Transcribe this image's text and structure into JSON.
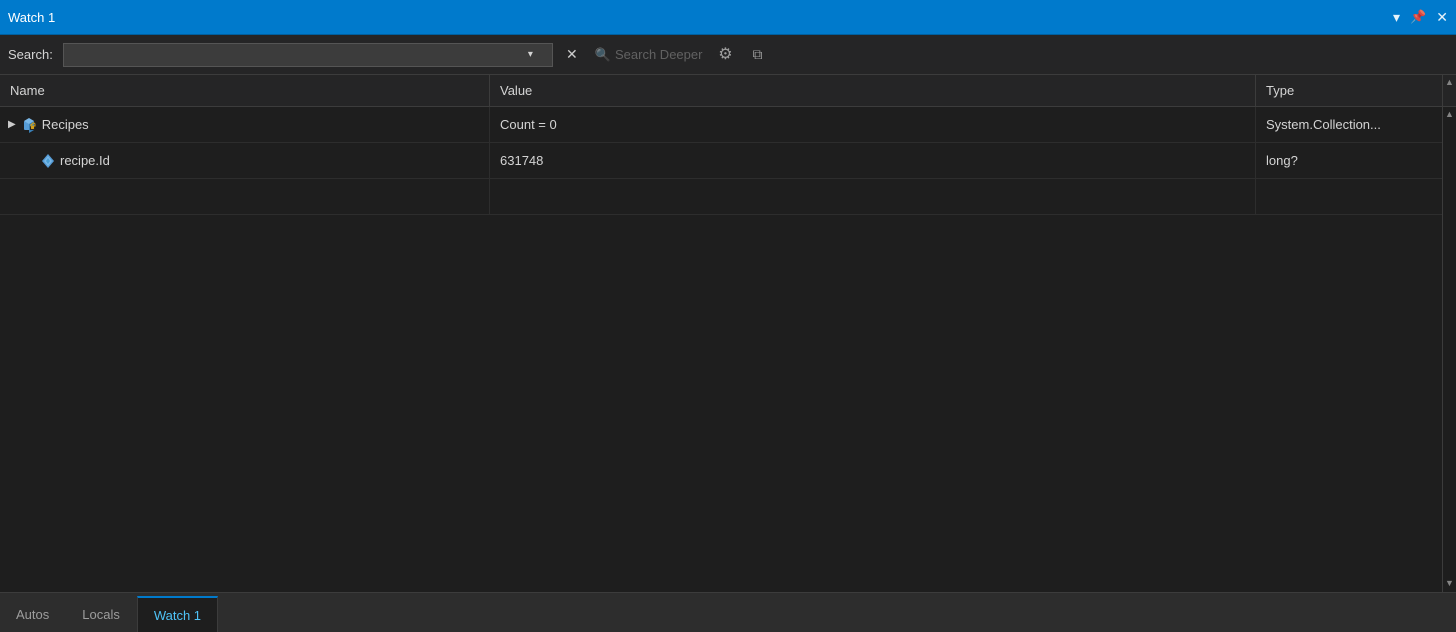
{
  "titleBar": {
    "title": "Watch 1",
    "controls": {
      "dropdown": "▾",
      "pin": "📌",
      "close": "✕"
    }
  },
  "toolbar": {
    "searchLabel": "Search:",
    "searchPlaceholder": "",
    "searchValue": "",
    "clearButton": "✕",
    "searchDeeperLabel": "Search Deeper",
    "searchDeeperIcon": "🔍",
    "gearIcon": "⚙",
    "collapseIcon": "⧉"
  },
  "columns": {
    "name": "Name",
    "value": "Value",
    "type": "Type"
  },
  "rows": [
    {
      "indent": 0,
      "expandable": true,
      "iconType": "cube-lock",
      "name": "Recipes",
      "value": "Count = 0",
      "type": "System.Collection..."
    },
    {
      "indent": 1,
      "expandable": false,
      "iconType": "diamond",
      "name": "recipe.Id",
      "value": "631748",
      "type": "long?"
    }
  ],
  "emptyRow": {
    "name": "",
    "value": "",
    "type": ""
  },
  "tabs": [
    {
      "label": "Autos",
      "active": false
    },
    {
      "label": "Locals",
      "active": false
    },
    {
      "label": "Watch 1",
      "active": true
    }
  ]
}
